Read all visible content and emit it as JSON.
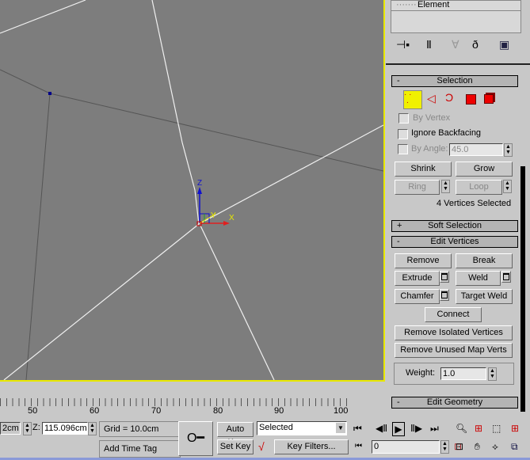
{
  "command_panel": {
    "subobject_item": "Element",
    "toolbar_icons": [
      "pin-stack-icon",
      "show-end-result-icon",
      "make-unique-icon",
      "remove-modifier-icon",
      "configure-modifier-sets-icon"
    ]
  },
  "selection": {
    "title": "Selection",
    "collapse": "-",
    "by_vertex": "By Vertex",
    "ignore_backfacing": "Ignore Backfacing",
    "by_angle": "By Angle:",
    "angle_value": "45.0",
    "shrink": "Shrink",
    "grow": "Grow",
    "ring": "Ring",
    "loop": "Loop",
    "status": "4 Vertices Selected"
  },
  "soft_selection": {
    "title": "Soft Selection",
    "expand": "+"
  },
  "edit_vertices": {
    "title": "Edit Vertices",
    "collapse": "-",
    "remove": "Remove",
    "break": "Break",
    "extrude": "Extrude",
    "weld": "Weld",
    "chamfer": "Chamfer",
    "target_weld": "Target Weld",
    "connect": "Connect",
    "remove_isolated": "Remove Isolated Vertices",
    "remove_unused": "Remove Unused Map Verts",
    "weight_label": "Weight:",
    "weight_value": "1.0"
  },
  "edit_geometry": {
    "title": "Edit Geometry",
    "collapse": "-"
  },
  "viewport": {
    "gizmo": {
      "z": "Z",
      "y": "Y",
      "x": "X"
    },
    "border_color": "#e8e800"
  },
  "timeline": {
    "ticks": [
      "50",
      "60",
      "70",
      "80",
      "90",
      "100"
    ]
  },
  "status": {
    "y_value": "2cm",
    "z_label": "Z:",
    "z_value": "115.096cm",
    "grid": "Grid = 10.0cm",
    "add_time_tag": "Add Time Tag",
    "auto_key": "Auto Key",
    "set_key": "Set Key",
    "key_mode": "Selected",
    "key_filters": "Key Filters...",
    "frame": "0"
  }
}
